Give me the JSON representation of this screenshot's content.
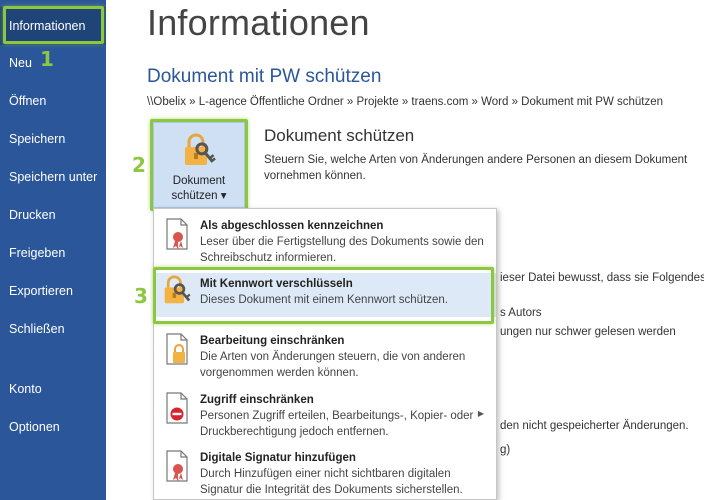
{
  "sidebar": {
    "items": [
      {
        "label": "Informationen"
      },
      {
        "label": "Neu"
      },
      {
        "label": "Öffnen"
      },
      {
        "label": "Speichern"
      },
      {
        "label": "Speichern unter"
      },
      {
        "label": "Drucken"
      },
      {
        "label": "Freigeben"
      },
      {
        "label": "Exportieren"
      },
      {
        "label": "Schließen"
      },
      {
        "label": "Konto"
      },
      {
        "label": "Optionen"
      }
    ]
  },
  "steps": [
    "1",
    "2",
    "3"
  ],
  "main": {
    "title": "Informationen",
    "doc_title": "Dokument mit PW schützen",
    "path": "\\\\Obelix » L-agence Öffentliche Ordner » Projekte » traens.com » Word » Dokument mit PW schützen",
    "protect_button": {
      "line1": "Dokument",
      "line2": "schützen ▾"
    },
    "protect_section": {
      "title": "Dokument schützen",
      "desc": "Steuern Sie, welche Arten von Änderungen andere Personen an diesem Dokument vornehmen können."
    },
    "hidden_text": {
      "line1": "ieser Datei bewusst, dass sie Folgendes",
      "line2": "s Autors",
      "line3": "ungen nur schwer gelesen werden",
      "line4": "den nicht gespeicherter Änderungen.",
      "line5": "g)"
    }
  },
  "menu": {
    "items": [
      {
        "title": "Als abgeschlossen kennzeichnen",
        "desc": "Leser über die Fertigstellung des Dokuments sowie den Schreibschutz informieren."
      },
      {
        "title": "Mit Kennwort verschlüsseln",
        "desc": "Dieses Dokument mit einem Kennwort schützen."
      },
      {
        "title": "Bearbeitung einschränken",
        "desc": "Die Arten von Änderungen steuern, die von anderen vorgenommen werden können."
      },
      {
        "title": "Zugriff einschränken",
        "desc": "Personen Zugriff erteilen, Bearbeitungs-, Kopier- oder Druckberechtigung jedoch entfernen."
      },
      {
        "title": "Digitale Signatur hinzufügen",
        "desc": "Durch Hinzufügen einer nicht sichtbaren digitalen Signatur die Integrität des Dokuments sicherstellen."
      }
    ]
  },
  "colors": {
    "sidebar": "#2b579a",
    "highlight": "#8dc63f",
    "accent": "#2b579a"
  }
}
